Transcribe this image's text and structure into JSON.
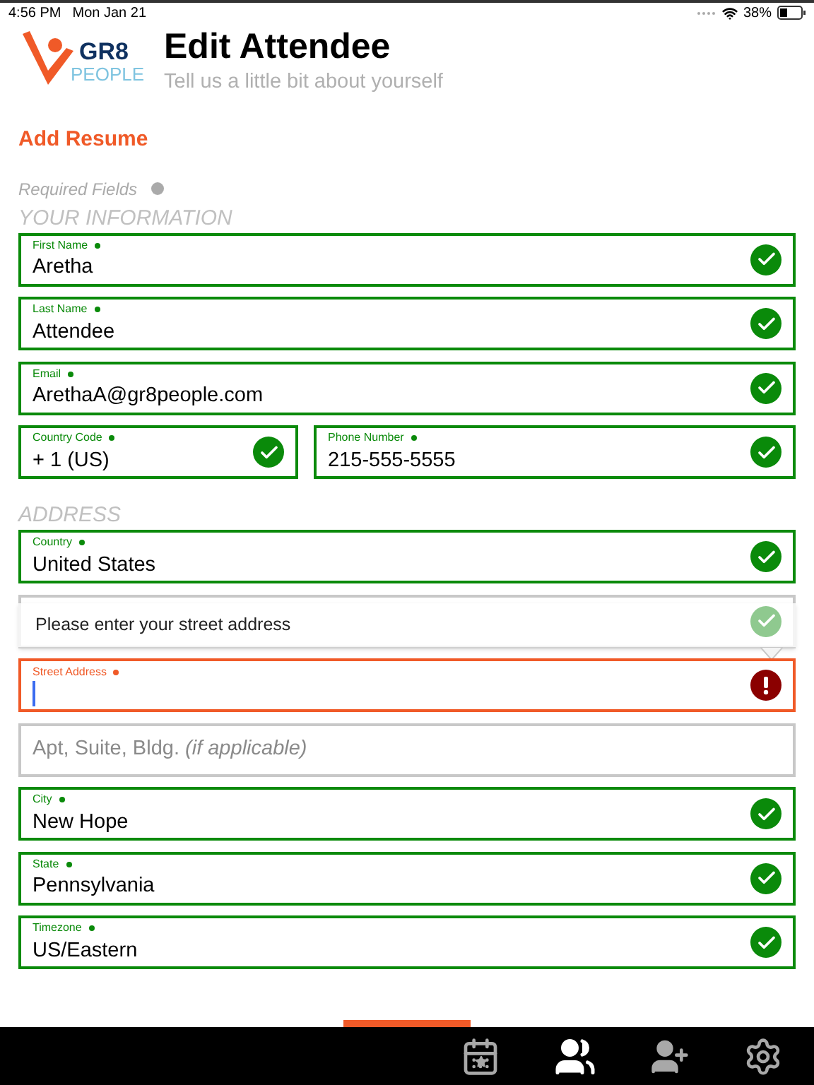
{
  "status_bar": {
    "time": "4:56 PM",
    "date": "Mon Jan 21",
    "battery": "38%"
  },
  "header": {
    "logo_top": "GR8",
    "logo_bottom": "PEOPLE",
    "title": "Edit Attendee",
    "subtitle": "Tell us a little bit about yourself"
  },
  "add_resume": "Add Resume",
  "required_note": "Required Fields",
  "sections": [
    {
      "heading": "YOUR INFORMATION",
      "rows": [
        [
          {
            "label": "First Name",
            "value": "Aretha",
            "valid": true,
            "invalid": false
          }
        ],
        [
          {
            "label": "Last Name",
            "value": "Attendee",
            "valid": true,
            "invalid": false
          }
        ],
        [
          {
            "label": "Email",
            "value": "ArethaA@gr8people.com",
            "valid": true,
            "invalid": false
          }
        ],
        [
          {
            "label": "Country Code",
            "value": "+ 1 (US)",
            "valid": true,
            "invalid": false
          },
          {
            "label": "Phone Number",
            "value": "215-555-5555",
            "valid": true,
            "invalid": false
          }
        ]
      ]
    },
    {
      "heading": "ADDRESS",
      "rows": [
        [
          {
            "label": "Country",
            "value": "United States",
            "valid": true,
            "invalid": false
          }
        ],
        [
          {
            "valid": true,
            "invalid": false,
            "tooltip": "Please enter your street address"
          }
        ],
        [
          {
            "label": "Street Address",
            "valid": false,
            "invalid": true,
            "focused": true
          }
        ],
        [
          {
            "placeholder": "Apt, Suite, Bldg. *(if applicable)*",
            "valid": false,
            "invalid": false
          }
        ],
        [
          {
            "label": "City",
            "value": "New Hope",
            "valid": true,
            "invalid": false
          }
        ],
        [
          {
            "label": "State",
            "value": "Pennsylvania",
            "valid": true,
            "invalid": false
          }
        ],
        [
          {
            "label": "Timezone",
            "value": "US/Eastern",
            "valid": true,
            "invalid": false
          }
        ]
      ]
    }
  ],
  "tabs": [
    {
      "kind": "events",
      "selected": false
    },
    {
      "kind": "attendees",
      "selected": true
    },
    {
      "kind": "add-attendee",
      "selected": false
    },
    {
      "kind": "settings",
      "selected": false
    }
  ]
}
